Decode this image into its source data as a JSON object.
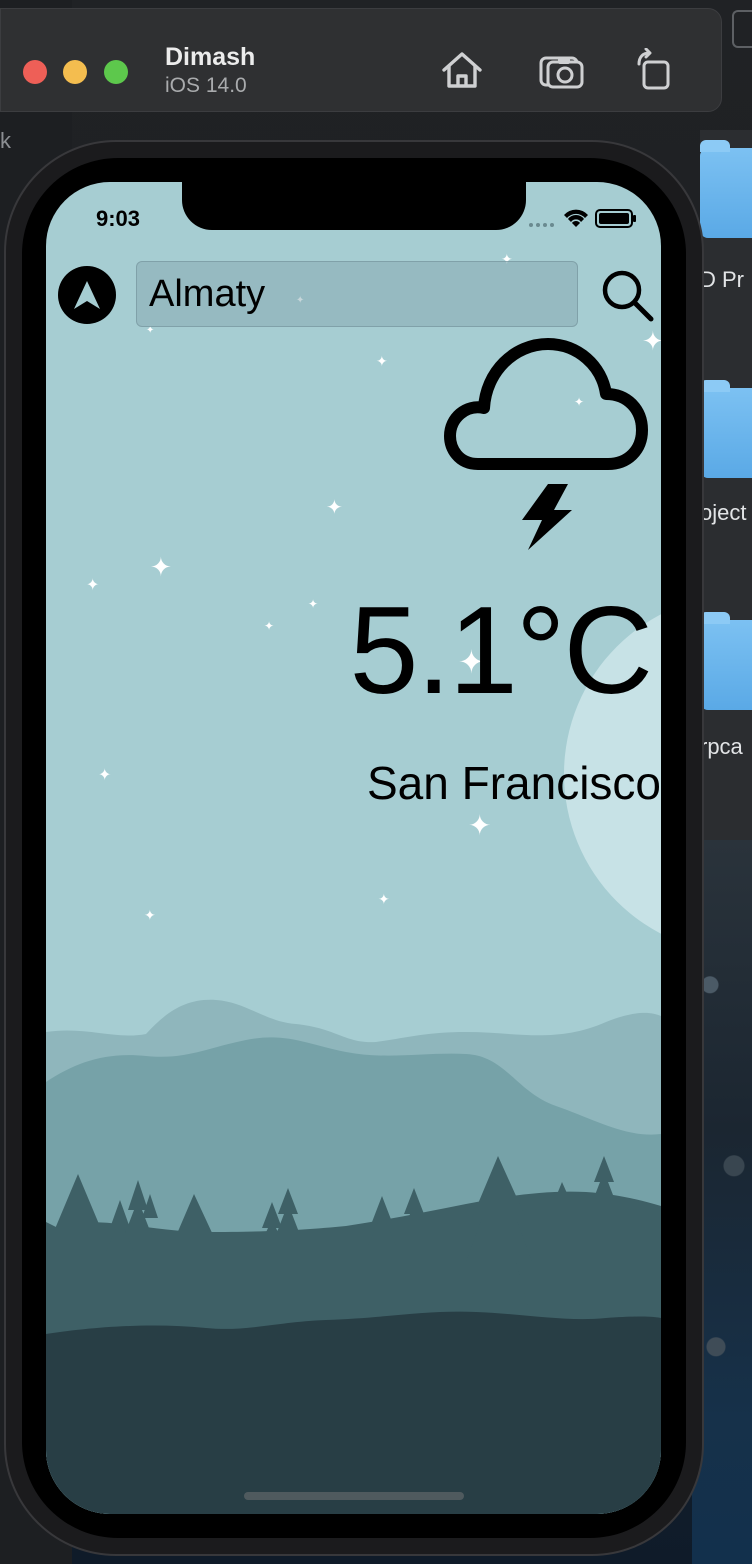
{
  "simulator": {
    "device_name": "Dimash",
    "os_version": "iOS 14.0",
    "toolbar": [
      "home-icon",
      "screenshot-icon",
      "rotate-icon"
    ]
  },
  "desktop": {
    "left_strip_text": "k",
    "finder_labels": [
      "D Pr",
      "oject",
      "rpca"
    ]
  },
  "status_bar": {
    "time": "9:03"
  },
  "app": {
    "search": {
      "value": "Almaty",
      "placeholder": ""
    },
    "weather": {
      "condition_icon": "cloud-bolt-icon",
      "temperature": "5.1°C",
      "city": "San Francisco"
    }
  },
  "colors": {
    "sky": "#a6cdd2",
    "moon": "#c7e2e6",
    "far_hills": "#8fb6bc",
    "mid_hills": "#76a2a8",
    "trees": "#3e6066",
    "foreground": "#283e45"
  }
}
